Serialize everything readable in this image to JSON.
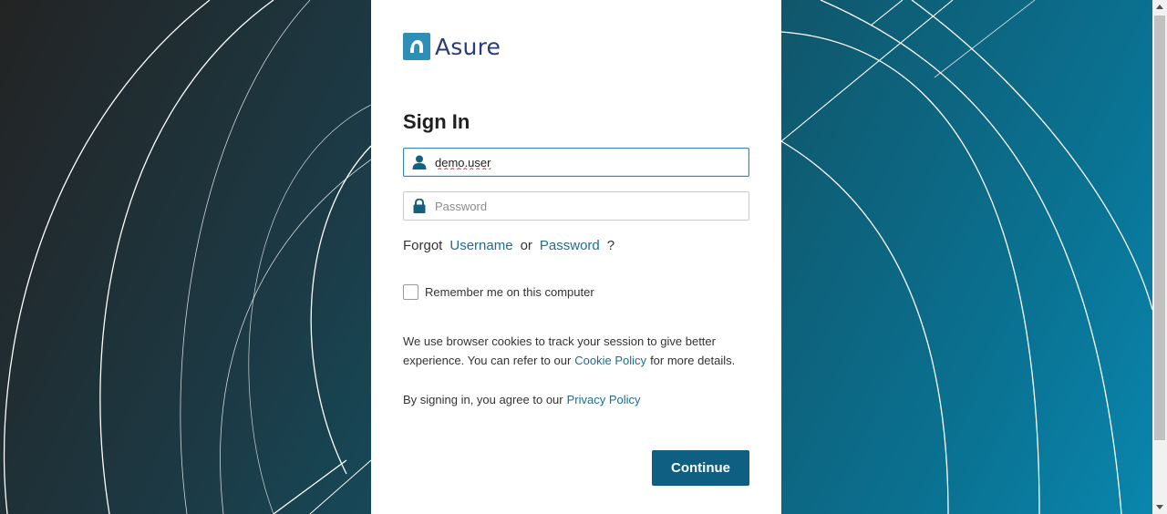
{
  "brand": {
    "name": "Asure",
    "mark_color": "#2c8fb3",
    "text_color": "#2a3a7a"
  },
  "form": {
    "title": "Sign In",
    "username": {
      "value": "demo.user",
      "icon": "user-icon"
    },
    "password": {
      "value": "",
      "placeholder": "Password",
      "icon": "lock-icon"
    },
    "forgot": {
      "prefix": "Forgot",
      "username_link": "Username",
      "or": "or",
      "password_link": "Password",
      "suffix": "?"
    },
    "remember_label": "Remember me on this computer",
    "remember_checked": false,
    "cookie_note": {
      "text_before": "We use browser cookies to track your session to give better experience. You can refer to our",
      "link": "Cookie Policy",
      "text_after": "for more details."
    },
    "privacy_note": {
      "text_before": "By signing in, you agree to our",
      "link": "Privacy Policy"
    },
    "continue_label": "Continue"
  },
  "colors": {
    "accent": "#0f5f82",
    "link": "#1b6e93"
  }
}
